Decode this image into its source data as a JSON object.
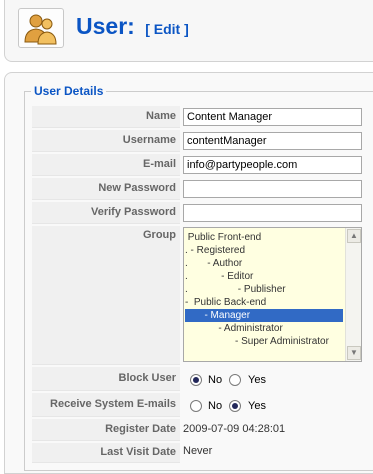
{
  "header": {
    "title": "User:",
    "subtitle": "[ Edit ]",
    "icon": "user-group-icon"
  },
  "legend": "User Details",
  "fields": {
    "name": {
      "label": "Name",
      "value": "Content Manager"
    },
    "username": {
      "label": "Username",
      "value": "contentManager"
    },
    "email": {
      "label": "E-mail",
      "value": "info@partypeople.com"
    },
    "new_password": {
      "label": "New Password",
      "value": ""
    },
    "verify_password": {
      "label": "Verify Password",
      "value": ""
    }
  },
  "group": {
    "label": "Group",
    "options": [
      " Public Front-end",
      ". - Registered",
      ".       - Author",
      ".            - Editor",
      ".                  - Publisher",
      "-  Public Back-end",
      "       - Manager",
      "            - Administrator",
      "                  - Super Administrator"
    ],
    "selected": "- Manager"
  },
  "block_user": {
    "label": "Block User",
    "no": "No",
    "yes": "Yes",
    "value": "No"
  },
  "receive_emails": {
    "label": "Receive System E-mails",
    "no": "No",
    "yes": "Yes",
    "value": "Yes"
  },
  "register_date": {
    "label": "Register Date",
    "value": "2009-07-09 04:28:01"
  },
  "last_visit": {
    "label": "Last Visit Date",
    "value": "Never"
  }
}
